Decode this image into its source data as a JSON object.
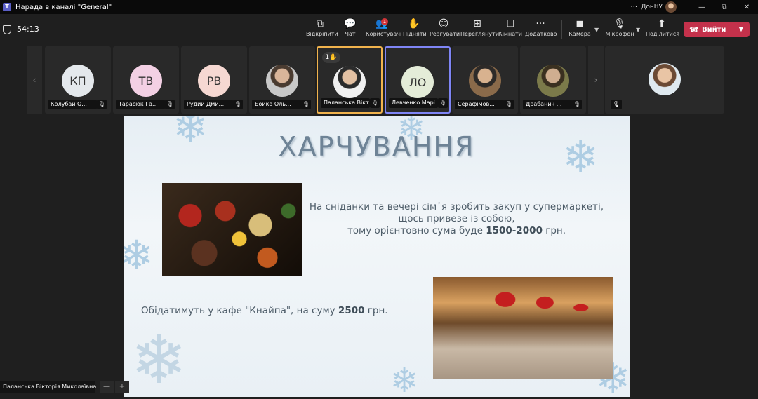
{
  "window": {
    "title": "Нарада в каналі \"General\"",
    "more": "···",
    "org": "ДонНУ",
    "minimize": "—",
    "restore": "⧉",
    "close": "✕"
  },
  "toolbar": {
    "timer": "54:13",
    "items": [
      {
        "label": "Відкріпити",
        "icon": "⧉"
      },
      {
        "label": "Чат",
        "icon": "💬"
      },
      {
        "label": "Користувачі",
        "icon": "👥",
        "badge": "1"
      },
      {
        "label": "Підняти",
        "icon": "✋"
      },
      {
        "label": "Реагувати",
        "icon": "☺"
      },
      {
        "label": "Переглянути",
        "icon": "⊞"
      },
      {
        "label": "Кімнати",
        "icon": "⧠"
      },
      {
        "label": "Додатково",
        "icon": "···"
      }
    ],
    "camera": {
      "label": "Камера",
      "icon": "◼"
    },
    "mic": {
      "label": "Мікрофон",
      "icon": "🎙"
    },
    "share": {
      "label": "Поділитися",
      "icon": "⬆"
    },
    "leave": {
      "label": "Вийти",
      "icon": "☎"
    }
  },
  "participants": [
    {
      "initials": "КП",
      "name": "Колубай О...",
      "color": "#e4e8ec"
    },
    {
      "initials": "ТВ",
      "name": "Тарасюк Га...",
      "color": "#f3d0e4"
    },
    {
      "initials": "РВ",
      "name": "Рудий Дми...",
      "color": "#f6d8d2"
    },
    {
      "initials": "",
      "name": "Бойко Оль...",
      "color": ""
    },
    {
      "initials": "",
      "name": "Паланська Вікт...",
      "color": "",
      "hand": "1✋"
    },
    {
      "initials": "ЛО",
      "name": "Левченко Марі...",
      "color": "#e4ecd8"
    },
    {
      "initials": "",
      "name": "Серафімов...",
      "color": ""
    },
    {
      "initials": "",
      "name": "Драбанич ...",
      "color": ""
    }
  ],
  "slide": {
    "title": "ХАРЧУВАННЯ",
    "text1_line1": "На сніданки та вечері сім᾿я зробить закуп у супермаркеті,",
    "text1_line2": "щось привезе із собою,",
    "text1_line3_prefix": "тому орієнтовно сума буде",
    "text1_amount": "1500-2000",
    "text1_suffix": "грн.",
    "text2_prefix": "Обідатимуть у кафе \"Кнайпа\", на суму",
    "text2_amount": "2500",
    "text2_suffix": "грн."
  },
  "presenter_name": "Паланська Вікторія Миколаївна",
  "zoom": {
    "minus": "—",
    "plus": "+"
  }
}
